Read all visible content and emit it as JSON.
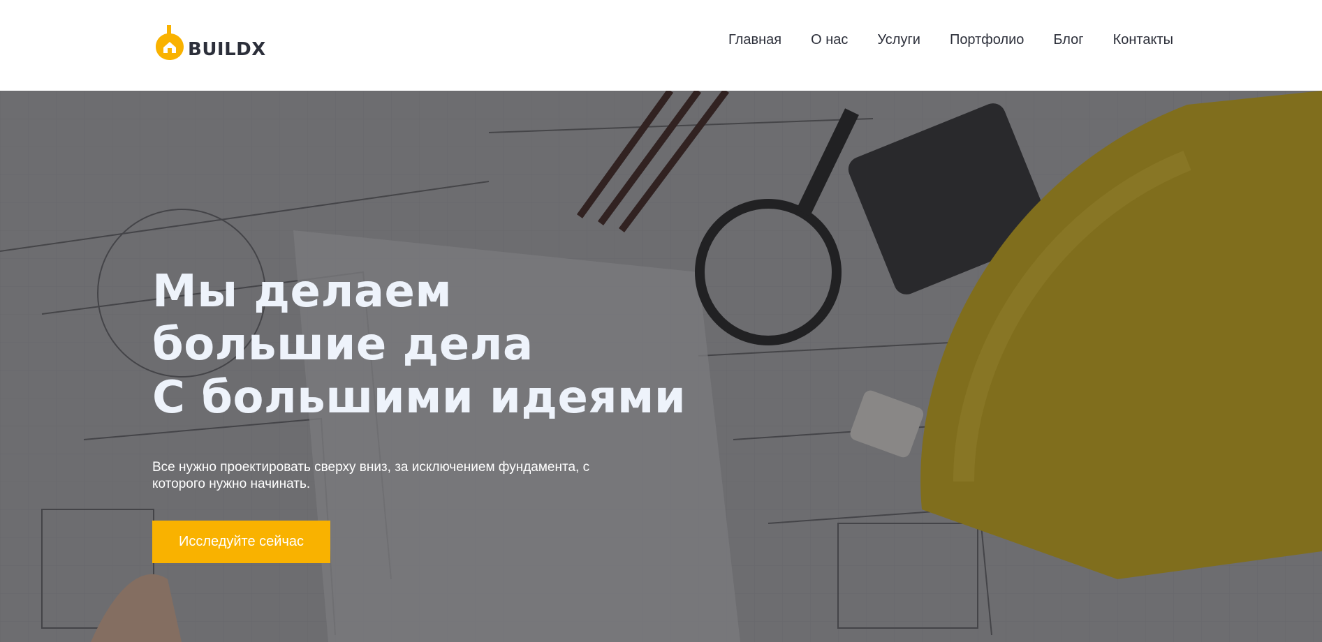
{
  "brand": {
    "name": "BUILDX",
    "accent": "#f9b200",
    "text_color": "#2c2f3a"
  },
  "nav": {
    "items": [
      {
        "label": "Главная"
      },
      {
        "label": "О нас"
      },
      {
        "label": "Услуги"
      },
      {
        "label": "Портфолио"
      },
      {
        "label": "Блог"
      },
      {
        "label": "Контакты"
      }
    ]
  },
  "hero": {
    "title_lines": [
      "Мы делаем",
      "большие дела",
      "С большими идеями"
    ],
    "subtitle": "Все нужно проектировать сверху вниз, за исключением фундамента, с которого нужно начинать.",
    "cta_label": "Исследуйте сейчас",
    "background_icon": "blueprint-desk-photo"
  }
}
